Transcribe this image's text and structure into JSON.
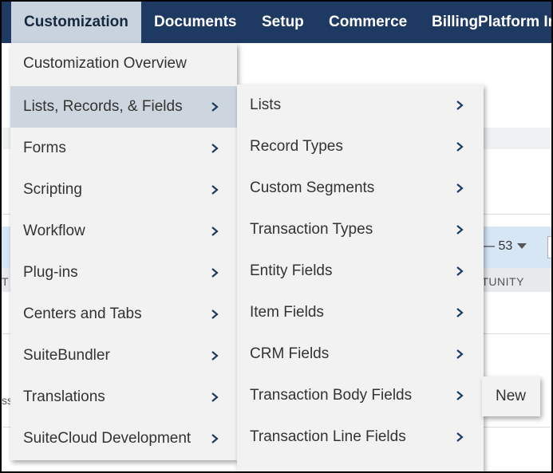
{
  "topnav": {
    "items": [
      {
        "label": "Customization",
        "active": true
      },
      {
        "label": "Documents"
      },
      {
        "label": "Setup"
      },
      {
        "label": "Commerce"
      },
      {
        "label": "BillingPlatform Ir"
      }
    ]
  },
  "background": {
    "pager_text": "— 53",
    "column_header": "RTUNITY",
    "left_fragment_1": "T",
    "left_fragment_2": "ss"
  },
  "menu_customization": {
    "items": [
      {
        "label": "Customization Overview",
        "submenu": false
      },
      {
        "label": "Lists, Records, & Fields",
        "submenu": true,
        "highlighted": true
      },
      {
        "label": "Forms",
        "submenu": true
      },
      {
        "label": "Scripting",
        "submenu": true
      },
      {
        "label": "Workflow",
        "submenu": true
      },
      {
        "label": "Plug-ins",
        "submenu": true
      },
      {
        "label": "Centers and Tabs",
        "submenu": true
      },
      {
        "label": "SuiteBundler",
        "submenu": true
      },
      {
        "label": "Translations",
        "submenu": true
      },
      {
        "label": "SuiteCloud Development",
        "submenu": true
      }
    ]
  },
  "menu_lists_records_fields": {
    "items": [
      {
        "label": "Lists"
      },
      {
        "label": "Record Types"
      },
      {
        "label": "Custom Segments"
      },
      {
        "label": "Transaction Types"
      },
      {
        "label": "Entity Fields"
      },
      {
        "label": "Item Fields"
      },
      {
        "label": "CRM Fields"
      },
      {
        "label": "Transaction Body Fields"
      },
      {
        "label": "Transaction Line Fields"
      }
    ]
  },
  "menu_transaction_body_fields": {
    "items": [
      {
        "label": "New"
      }
    ]
  },
  "colors": {
    "nav_bg": "#1f3a62",
    "nav_active_bg": "#c9d3de",
    "menu_bg": "#f2f2f2",
    "menu_highlight": "#cdd5de",
    "chevron": "#1f3a62"
  }
}
